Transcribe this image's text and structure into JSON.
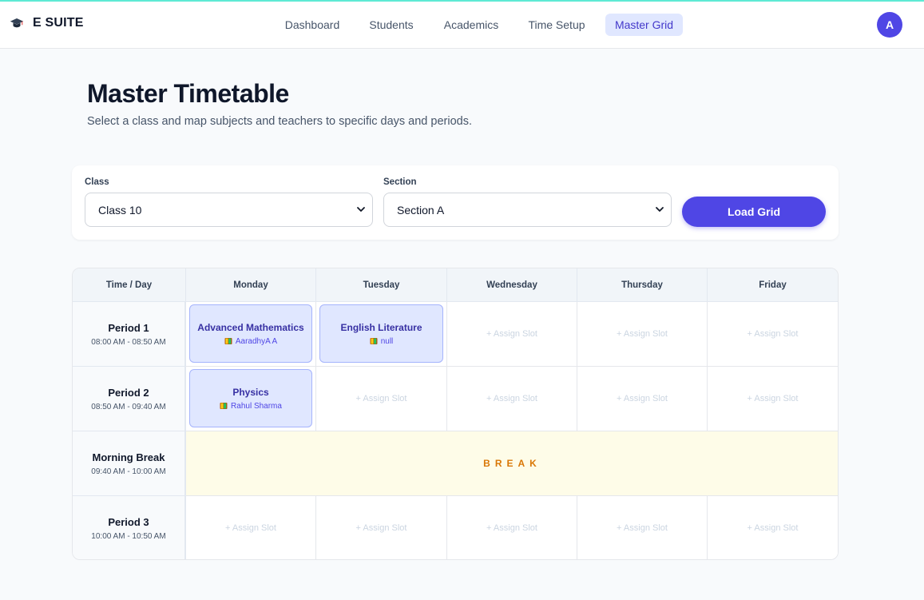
{
  "app": {
    "title": "E SUITE"
  },
  "nav": {
    "items": [
      {
        "label": "Dashboard"
      },
      {
        "label": "Students"
      },
      {
        "label": "Academics"
      },
      {
        "label": "Time Setup"
      },
      {
        "label": "Master Grid",
        "active": true
      }
    ],
    "avatar_initial": "A"
  },
  "page": {
    "title": "Master Timetable",
    "subtitle": "Select a class and map subjects and teachers to specific days and periods."
  },
  "filters": {
    "class_label": "Class",
    "class_value": "Class 10",
    "section_label": "Section",
    "section_value": "Section A",
    "load_button": "Load Grid"
  },
  "grid": {
    "corner": "Time / Day",
    "days": [
      "Monday",
      "Tuesday",
      "Wednesday",
      "Thursday",
      "Friday"
    ],
    "assign_label": "+ Assign Slot",
    "break_label": "BREAK",
    "rows": [
      {
        "name": "Period 1",
        "time": "08:00 AM - 08:50 AM",
        "slots": [
          {
            "subject": "Advanced Mathematics",
            "teacher": "AaradhyA A"
          },
          {
            "subject": "English Literature",
            "teacher": "null"
          },
          null,
          null,
          null
        ]
      },
      {
        "name": "Period 2",
        "time": "08:50 AM - 09:40 AM",
        "slots": [
          {
            "subject": "Physics",
            "teacher": "Rahul Sharma"
          },
          null,
          null,
          null,
          null
        ]
      },
      {
        "name": "Morning Break",
        "time": "09:40 AM - 10:00 AM",
        "is_break": true
      },
      {
        "name": "Period 3",
        "time": "10:00 AM - 10:50 AM",
        "slots": [
          null,
          null,
          null,
          null,
          null
        ]
      }
    ]
  },
  "colors": {
    "accent": "#4f46e5",
    "slot_bg": "#e0e7ff",
    "break_bg": "#fefce8",
    "break_text": "#d97706"
  }
}
